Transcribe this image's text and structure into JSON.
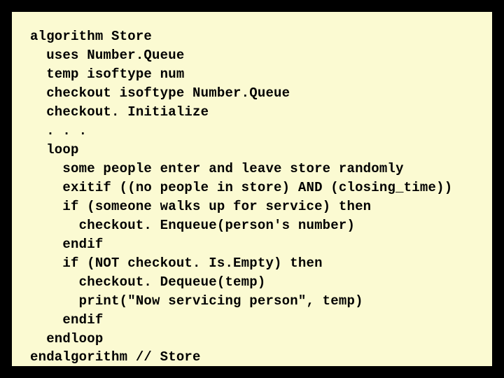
{
  "code": {
    "lines": [
      "algorithm Store",
      "  uses Number.Queue",
      "  temp isoftype num",
      "  checkout isoftype Number.Queue",
      "  checkout. Initialize",
      "  . . .",
      "  loop",
      "    some people enter and leave store randomly",
      "    exitif ((no people in store) AND (closing_time))",
      "    if (someone walks up for service) then",
      "      checkout. Enqueue(person's number)",
      "    endif",
      "    if (NOT checkout. Is.Empty) then",
      "      checkout. Dequeue(temp)",
      "      print(\"Now servicing person\", temp)",
      "    endif",
      "  endloop",
      "endalgorithm // Store"
    ]
  }
}
